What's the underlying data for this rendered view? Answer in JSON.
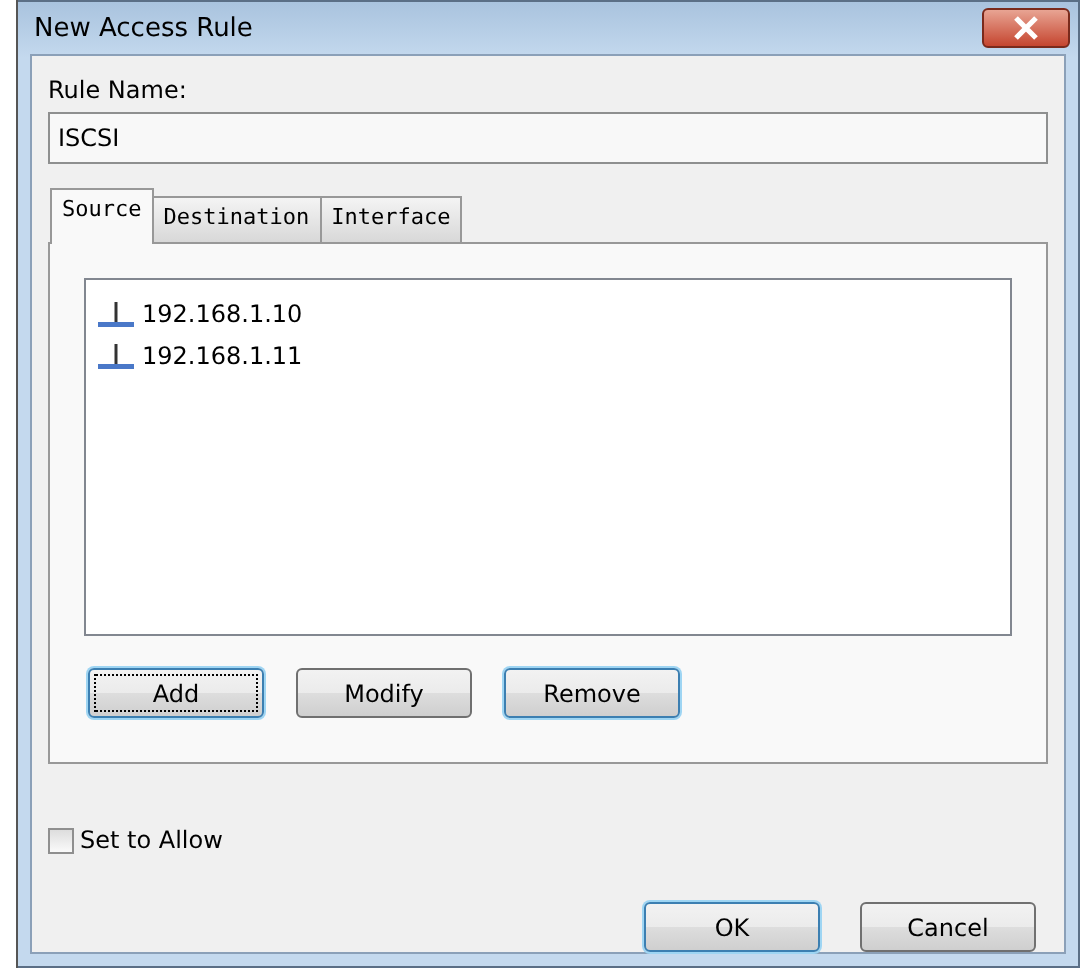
{
  "window": {
    "title": "New Access Rule"
  },
  "rule_name": {
    "label": "Rule Name:",
    "value": "ISCSI"
  },
  "tabs": [
    {
      "label": "Source",
      "selected": true
    },
    {
      "label": "Destination",
      "selected": false
    },
    {
      "label": "Interface",
      "selected": false
    }
  ],
  "source_list": [
    "192.168.1.10",
    "192.168.1.11"
  ],
  "list_buttons": [
    {
      "label": "Add",
      "focused": true,
      "highlighted": true
    },
    {
      "label": "Modify",
      "focused": false,
      "highlighted": false
    },
    {
      "label": "Remove",
      "focused": false,
      "highlighted": true
    }
  ],
  "set_to_allow": {
    "label": "Set to Allow",
    "checked": false
  },
  "dialog_buttons": [
    {
      "label": "OK",
      "focused": false,
      "highlighted": true
    },
    {
      "label": "Cancel",
      "focused": false,
      "highlighted": false
    }
  ]
}
